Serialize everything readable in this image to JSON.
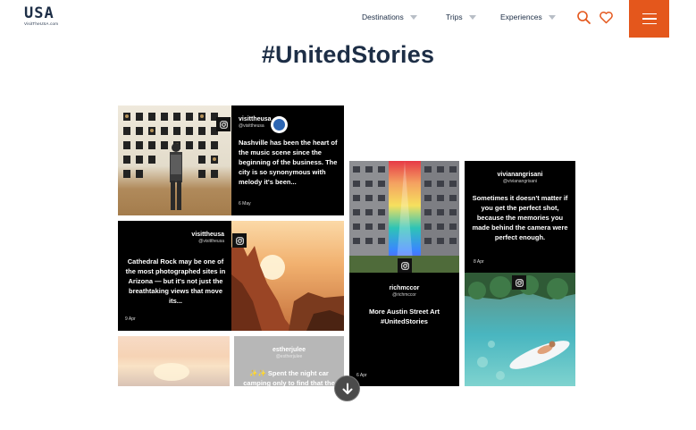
{
  "header": {
    "logo_text": "USA",
    "logo_sub": "VisitTheUSA.com",
    "nav": [
      {
        "label": "Destinations"
      },
      {
        "label": "Trips"
      },
      {
        "label": "Experiences"
      }
    ],
    "search_icon": "search-icon",
    "heart_icon": "heart-icon",
    "menu_icon": "hamburger-menu-icon",
    "accent_color": "#e4571c"
  },
  "page": {
    "title": "#UnitedStories"
  },
  "posts": [
    {
      "user": "visittheusa",
      "handle": "@visittheusa",
      "text": "Nashville has been the heart of the music scene since the beginning of the business. The city is so synonymous with melody it's been...",
      "date": "6 May"
    },
    {
      "user": "visittheusa",
      "handle": "@visittheusa",
      "text": "Cathedral Rock may be one of the most photographed sites in Arizona — but it's not just the breathtaking views that move its...",
      "date": "9 Apr"
    },
    {
      "user": "estherjulee",
      "handle": "@estherjulee",
      "text": "✨✨ Spent the night car camping only to find that the"
    },
    {
      "user": "richmccor",
      "handle": "@richmccor",
      "text": "More Austin Street Art #UnitedStories",
      "date": "6 Apr"
    },
    {
      "user": "vivianangrisani",
      "handle": "@vivianangrisani",
      "text": "Sometimes it doesn't matter if you get the perfect shot, because the memories you made behind the camera were perfect enough.",
      "date": "8 Apr"
    }
  ],
  "scroll_icon": "arrow-down-icon"
}
